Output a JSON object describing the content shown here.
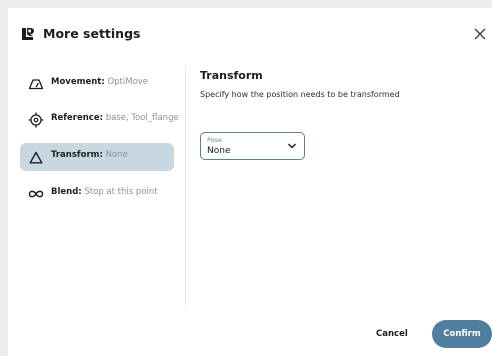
{
  "header": {
    "title": "More settings",
    "logo_icon": "ur-logo-icon",
    "close_icon": "close-icon"
  },
  "sidebar": {
    "items": [
      {
        "label": "Movement:",
        "value": "OptiMove",
        "icon": "gauge-icon",
        "active": false
      },
      {
        "label": "Reference:",
        "value": "base, Tool_flange",
        "icon": "crosshair-icon",
        "active": false
      },
      {
        "label": "Transform:",
        "value": "None",
        "icon": "triangle-icon",
        "active": true
      },
      {
        "label": "Blend:",
        "value": "Stop at this point",
        "icon": "infinity-icon",
        "active": false
      }
    ]
  },
  "main": {
    "title": "Transform",
    "description": "Specify how the position needs to be transformed",
    "pose_select": {
      "label": "Pose",
      "value": "None"
    }
  },
  "footer": {
    "cancel_label": "Cancel",
    "confirm_label": "Confirm"
  },
  "colors": {
    "accent": "#4f7e9e",
    "active_item_bg": "#c9d7e0",
    "muted_text": "#8a9199"
  }
}
